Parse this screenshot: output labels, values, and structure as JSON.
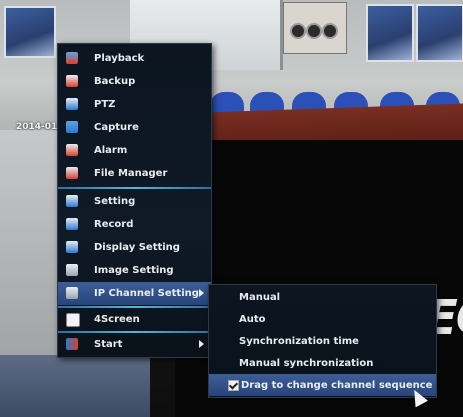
{
  "main_menu": {
    "items": [
      {
        "label": "Playback",
        "icon": "playback-icon"
      },
      {
        "label": "Backup",
        "icon": "backup-icon"
      },
      {
        "label": "PTZ",
        "icon": "ptz-icon"
      },
      {
        "label": "Capture",
        "icon": "capture-icon"
      },
      {
        "label": "Alarm",
        "icon": "alarm-icon"
      },
      {
        "label": "File Manager",
        "icon": "file-manager-icon"
      },
      {
        "label": "Setting",
        "icon": "setting-icon"
      },
      {
        "label": "Record",
        "icon": "record-icon"
      },
      {
        "label": "Display Setting",
        "icon": "display-setting-icon"
      },
      {
        "label": "Image Setting",
        "icon": "image-setting-icon"
      },
      {
        "label": "IP Channel Setting",
        "icon": "ip-channel-icon"
      },
      {
        "label": "4Screen",
        "icon": "four-screen-icon"
      },
      {
        "label": "Start",
        "icon": "start-icon"
      }
    ]
  },
  "sub_menu": {
    "items": [
      {
        "label": "Manual"
      },
      {
        "label": "Auto"
      },
      {
        "label": "Synchronization time"
      },
      {
        "label": "Manual synchronization"
      },
      {
        "label": "Drag to change channel sequence",
        "checked": true
      }
    ]
  },
  "colors": {
    "menu_bg": "#0c1520",
    "highlight": "#3d5e96",
    "separator": "#58b3d8"
  }
}
